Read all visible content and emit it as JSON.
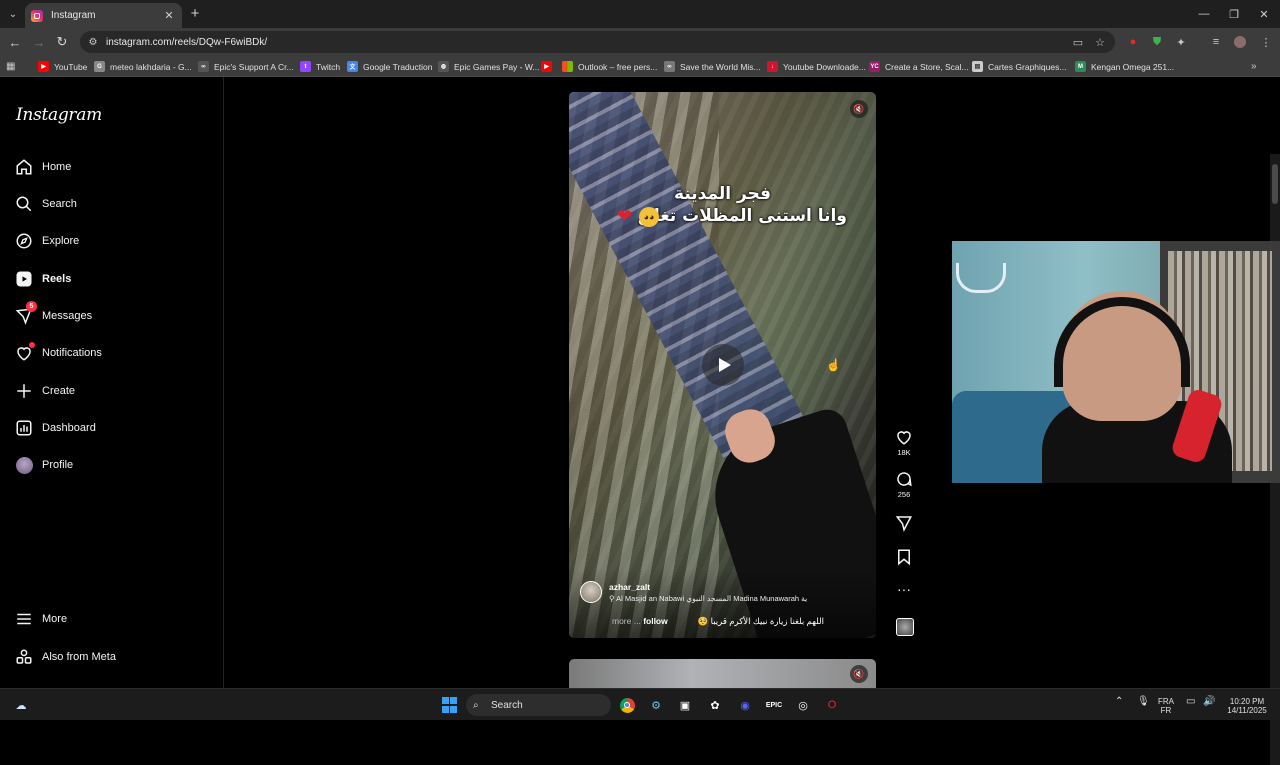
{
  "browser": {
    "tab_title": "Instagram",
    "url": "instagram.com/reels/DQw-F6wiBDk/",
    "bookmarks": [
      {
        "label": "YouTube",
        "color": "#ff0000"
      },
      {
        "label": "meteo lakhdaria - G...",
        "color": "#888888"
      },
      {
        "label": "Epic's Support A Cr...",
        "color": "#555555"
      },
      {
        "label": "Twitch",
        "color": "#9146ff"
      },
      {
        "label": "Google Traduction",
        "color": "#4285f4"
      },
      {
        "label": "Epic Games Pay - W...",
        "color": "#555555"
      },
      {
        "label": "",
        "color": "#ff0000"
      },
      {
        "label": "Outlook – free pers...",
        "color": "#f25022"
      },
      {
        "label": "Save the World Mis...",
        "color": "#777777"
      },
      {
        "label": "Youtube Downloade...",
        "color": "#d0142c"
      },
      {
        "label": "Create a Store, Scal...",
        "color": "#9b1b6b"
      },
      {
        "label": "Cartes Graphiques...",
        "color": "#cccccc"
      },
      {
        "label": "Kengan Omega 251...",
        "color": "#2e8b57"
      }
    ]
  },
  "instagram": {
    "logo": "Instagram",
    "nav": [
      {
        "label": "Home",
        "icon": "home-icon"
      },
      {
        "label": "Search",
        "icon": "search-icon"
      },
      {
        "label": "Explore",
        "icon": "compass-icon"
      },
      {
        "label": "Reels",
        "icon": "reels-icon"
      },
      {
        "label": "Messages",
        "icon": "messenger-icon",
        "badge": "5"
      },
      {
        "label": "Notifications",
        "icon": "heart-icon"
      },
      {
        "label": "Create",
        "icon": "plus-icon"
      },
      {
        "label": "Dashboard",
        "icon": "dashboard-icon"
      },
      {
        "label": "Profile",
        "icon": "avatar"
      }
    ],
    "bottom_nav": [
      {
        "label": "More",
        "icon": "menu-icon"
      },
      {
        "label": "Also from Meta",
        "icon": "meta-icon"
      }
    ],
    "reel": {
      "overlay_line1": "فجر المدينة",
      "overlay_line2": "وانا استنى المظلات تغلق",
      "username": "azhar_zalt",
      "location": "Al Masjid an Nabawi المسجد النبوي Madina Munawarah ية",
      "description": "اللهم بلغنا زيارة نبيك الأكرم قريبا 🥺",
      "more": "more ...",
      "follow": "follow",
      "likes": "18K",
      "comments": "256"
    }
  },
  "taskbar": {
    "search_placeholder": "Search",
    "lang_top": "FRA",
    "lang_bottom": "FR",
    "time": "10:20 PM",
    "date": "14/11/2025"
  }
}
